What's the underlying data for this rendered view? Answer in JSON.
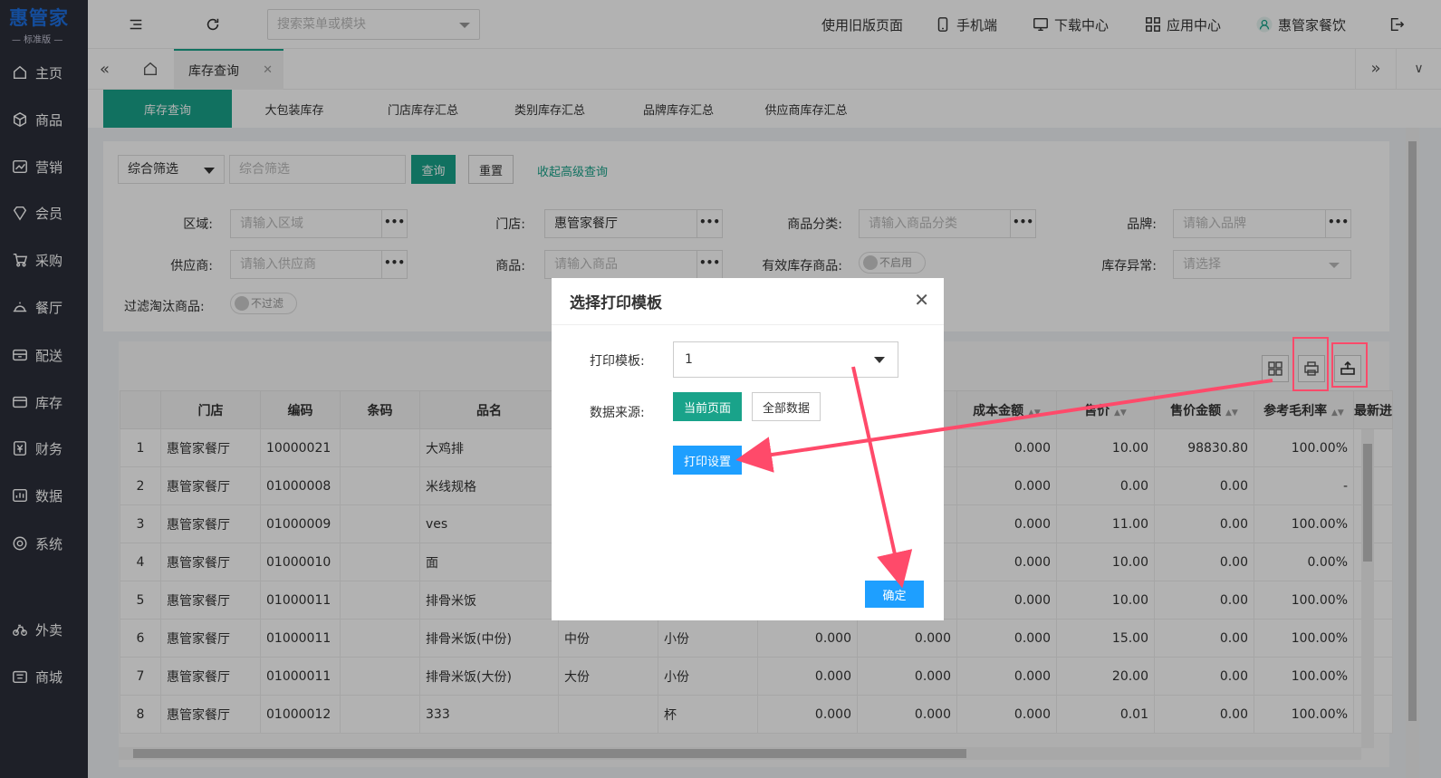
{
  "sidebar": {
    "logo_title": "惠管家",
    "logo_sub": "— 标准版 —",
    "items": [
      {
        "label": "主页",
        "icon": "home-icon"
      },
      {
        "label": "商品",
        "icon": "cube-icon"
      },
      {
        "label": "营销",
        "icon": "trend-icon"
      },
      {
        "label": "会员",
        "icon": "diamond-icon"
      },
      {
        "label": "采购",
        "icon": "cart-icon"
      },
      {
        "label": "餐厅",
        "icon": "dish-icon"
      },
      {
        "label": "配送",
        "icon": "delivery-icon"
      },
      {
        "label": "库存",
        "icon": "inventory-icon"
      },
      {
        "label": "财务",
        "icon": "yuan-icon"
      },
      {
        "label": "数据",
        "icon": "chart-icon"
      },
      {
        "label": "系统",
        "icon": "settings-icon"
      },
      {
        "label": "外卖",
        "icon": "bike-icon"
      },
      {
        "label": "商城",
        "icon": "shop-icon"
      }
    ]
  },
  "topbar": {
    "search_placeholder": "搜索菜单或模块",
    "old_version": "使用旧版页面",
    "mobile": "手机端",
    "download": "下载中心",
    "apps": "应用中心",
    "user": "惠管家餐饮"
  },
  "tabs": {
    "current": "库存查询"
  },
  "subtabs": [
    "库存查询",
    "大包装库存",
    "门店库存汇总",
    "类别库存汇总",
    "品牌库存汇总",
    "供应商库存汇总"
  ],
  "filter": {
    "combo_label": "综合筛选",
    "combo_placeholder": "综合筛选",
    "query_btn": "查询",
    "reset_btn": "重置",
    "collapse_link": "收起高级查询",
    "area_label": "区域:",
    "area_placeholder": "请输入区域",
    "store_label": "门店:",
    "store_value": "惠管家餐厅",
    "category_label": "商品分类:",
    "category_placeholder": "请输入商品分类",
    "brand_label": "品牌:",
    "brand_placeholder": "请输入品牌",
    "supplier_label": "供应商:",
    "supplier_placeholder": "请输入供应商",
    "goods_label": "商品:",
    "goods_placeholder": "请输入商品",
    "valid_stock_label": "有效库存商品:",
    "valid_stock_toggle": "不启用",
    "stock_abnormal_label": "库存异常:",
    "stock_abnormal_placeholder": "请选择",
    "filter_eliminated_label": "过滤淘汰商品:",
    "filter_eliminated_toggle": "不过滤"
  },
  "table": {
    "headers": [
      "",
      "门店",
      "编码",
      "条码",
      "品名",
      "",
      "",
      "",
      "",
      "成本金额",
      "售价",
      "售价金额",
      "参考毛利率",
      "最新进"
    ],
    "rows": [
      {
        "no": "1",
        "store": "惠管家餐厅",
        "code": "10000021",
        "barcode": "",
        "name": "大鸡排",
        "spec": "",
        "unit": "",
        "c1": "",
        "c2": "",
        "cost": "0.000",
        "price": "10.00",
        "amount": "98830.80",
        "margin": "100.00%"
      },
      {
        "no": "2",
        "store": "惠管家餐厅",
        "code": "01000008",
        "barcode": "",
        "name": "米线规格",
        "spec": "",
        "unit": "",
        "c1": "",
        "c2": "",
        "cost": "0.000",
        "price": "0.00",
        "amount": "0.00",
        "margin": "-"
      },
      {
        "no": "3",
        "store": "惠管家餐厅",
        "code": "01000009",
        "barcode": "",
        "name": "ves",
        "spec": "",
        "unit": "",
        "c1": "",
        "c2": "",
        "cost": "0.000",
        "price": "11.00",
        "amount": "0.00",
        "margin": "100.00%"
      },
      {
        "no": "4",
        "store": "惠管家餐厅",
        "code": "01000010",
        "barcode": "",
        "name": "面",
        "spec": "",
        "unit": "",
        "c1": "",
        "c2": "",
        "cost": "0.000",
        "price": "10.00",
        "amount": "0.00",
        "margin": "0.00%"
      },
      {
        "no": "5",
        "store": "惠管家餐厅",
        "code": "01000011",
        "barcode": "",
        "name": "排骨米饭",
        "spec": "",
        "unit": "",
        "c1": "",
        "c2": "",
        "cost": "0.000",
        "price": "10.00",
        "amount": "0.00",
        "margin": "100.00%"
      },
      {
        "no": "6",
        "store": "惠管家餐厅",
        "code": "01000011",
        "barcode": "",
        "name": "排骨米饭(中份)",
        "spec": "中份",
        "unit": "小份",
        "c1": "0.000",
        "c2": "0.000",
        "cost": "0.000",
        "price": "15.00",
        "amount": "0.00",
        "margin": "100.00%"
      },
      {
        "no": "7",
        "store": "惠管家餐厅",
        "code": "01000011",
        "barcode": "",
        "name": "排骨米饭(大份)",
        "spec": "大份",
        "unit": "小份",
        "c1": "0.000",
        "c2": "0.000",
        "cost": "0.000",
        "price": "20.00",
        "amount": "0.00",
        "margin": "100.00%"
      },
      {
        "no": "8",
        "store": "惠管家餐厅",
        "code": "01000012",
        "barcode": "",
        "name": "333",
        "spec": "",
        "unit": "杯",
        "c1": "0.000",
        "c2": "0.000",
        "cost": "0.000",
        "price": "0.01",
        "amount": "0.00",
        "margin": "100.00%"
      }
    ]
  },
  "modal": {
    "title": "选择打印模板",
    "template_label": "打印模板:",
    "template_value": "1",
    "source_label": "数据来源:",
    "current_page_btn": "当前页面",
    "all_data_btn": "全部数据",
    "print_settings_btn": "打印设置",
    "confirm_btn": "确定"
  },
  "colors": {
    "accent": "#19a38a",
    "sidebar": "#2b2f3a",
    "primary_blue": "#1e9fff",
    "annotation": "#ff4a6a"
  }
}
